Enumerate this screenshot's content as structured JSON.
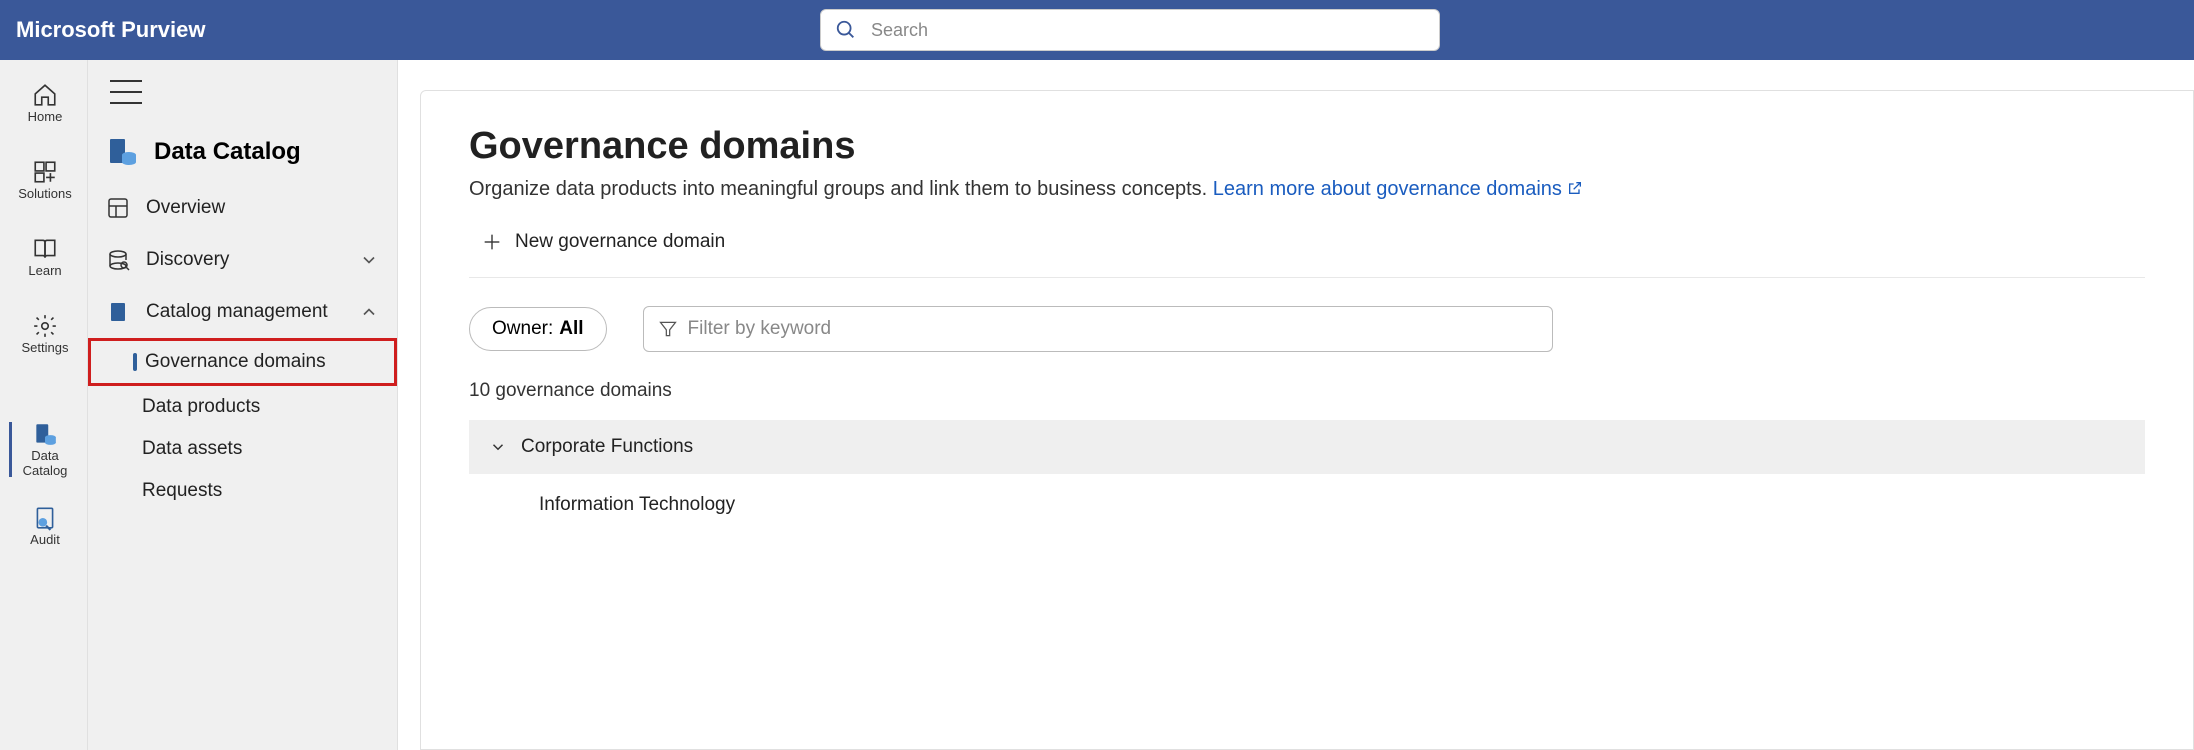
{
  "header": {
    "title": "Microsoft Purview",
    "search_placeholder": "Search"
  },
  "leftRail": {
    "items": [
      "Home",
      "Solutions",
      "Learn",
      "Settings"
    ],
    "secondary": [
      "Data Catalog",
      "Audit"
    ]
  },
  "secondNav": {
    "sectionTitle": "Data Catalog",
    "overview": "Overview",
    "discovery": "Discovery",
    "catalogMgmt": "Catalog management",
    "subItems": [
      "Governance domains",
      "Data products",
      "Data assets",
      "Requests"
    ]
  },
  "main": {
    "pageTitle": "Governance domains",
    "pageDesc": "Organize data products into meaningful groups and link them to business concepts. ",
    "learnMore": "Learn more about governance domains",
    "newDomain": "New governance domain",
    "ownerLabel": "Owner: ",
    "ownerValue": "All",
    "filterPlaceholder": "Filter by keyword",
    "countText": "10 governance domains",
    "groupHeader": "Corporate Functions",
    "groupChild": "Information Technology"
  }
}
